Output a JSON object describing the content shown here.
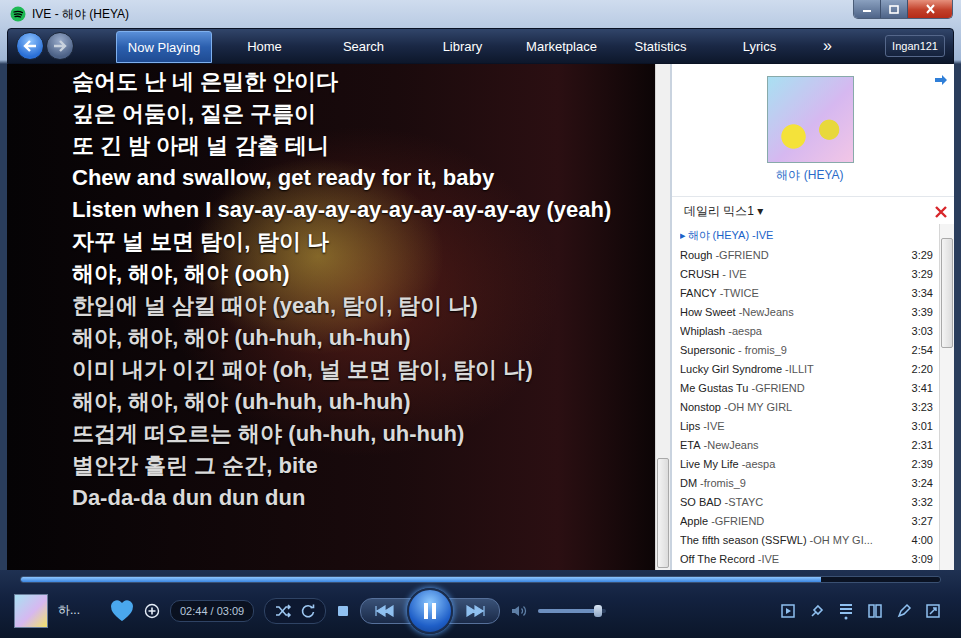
{
  "window": {
    "title": "IVE - 해야 (HEYA)"
  },
  "tabs": [
    {
      "label": "Now Playing",
      "selected": true
    },
    {
      "label": "Home",
      "selected": false
    },
    {
      "label": "Search",
      "selected": false
    },
    {
      "label": "Library",
      "selected": false
    },
    {
      "label": "Marketplace",
      "selected": false
    },
    {
      "label": "Statistics",
      "selected": false
    },
    {
      "label": "Lyrics",
      "selected": false
    }
  ],
  "nav_more": "»",
  "user": "Ingan121",
  "lyrics": [
    {
      "text": "숨어도 난 네 은밀한 안이다",
      "played": true
    },
    {
      "text": "깊은 어둠이, 짙은 구름이",
      "played": true
    },
    {
      "text": "또 긴 밤 아래 널 감출 테니",
      "played": true
    },
    {
      "text": "Chew and swallow, get ready for it, baby",
      "played": true
    },
    {
      "text": "Listen when I say-ay-ay-ay-ay-ay-ay-ay-ay-ay (yeah)",
      "played": true
    },
    {
      "text": "자꾸 널 보면 탐이, 탐이 나",
      "played": true
    },
    {
      "text": "해야, 해야, 해야 (ooh)",
      "played": true
    },
    {
      "text": "한입에 널 삼킬 때야 (yeah, 탐이, 탐이 나)",
      "played": false
    },
    {
      "text": "해야, 해야, 해야 (uh-huh, uh-huh)",
      "played": false
    },
    {
      "text": "이미 내가 이긴 패야 (oh, 널 보면 탐이, 탐이 나)",
      "played": false
    },
    {
      "text": "해야, 해야, 해야 (uh-huh, uh-huh)",
      "played": false
    },
    {
      "text": "뜨겁게 떠오르는 해야 (uh-huh, uh-huh)",
      "played": false
    },
    {
      "text": "별안간 홀린 그 순간, bite",
      "played": false
    },
    {
      "text": "Da-da-da dun dun dun",
      "played": false
    }
  ],
  "now_playing": {
    "caption": "해야 (HEYA)"
  },
  "playlist": {
    "name": "데일리 믹스1",
    "dropdown": "▾",
    "marker": "▸"
  },
  "queue": [
    {
      "title": "해야 (HEYA)",
      "artist": "-IVE",
      "duration": "",
      "selected": true
    },
    {
      "title": "Rough",
      "artist": "-GFRIEND",
      "duration": "3:29",
      "selected": false
    },
    {
      "title": "CRUSH",
      "artist": "- IVE",
      "duration": "3:29",
      "selected": false
    },
    {
      "title": "FANCY",
      "artist": "-TWICE",
      "duration": "3:34",
      "selected": false
    },
    {
      "title": "How Sweet",
      "artist": "-NewJeans",
      "duration": "3:39",
      "selected": false
    },
    {
      "title": "Whiplash",
      "artist": "-aespa",
      "duration": "3:03",
      "selected": false
    },
    {
      "title": "Supersonic",
      "artist": "- fromis_9",
      "duration": "2:54",
      "selected": false
    },
    {
      "title": "Lucky Girl Syndrome",
      "artist": "-ILLIT",
      "duration": "2:20",
      "selected": false
    },
    {
      "title": "Me Gustas Tu",
      "artist": "-GFRIEND",
      "duration": "3:41",
      "selected": false
    },
    {
      "title": "Nonstop",
      "artist": "-OH MY GIRL",
      "duration": "3:23",
      "selected": false
    },
    {
      "title": "Lips",
      "artist": "-IVE",
      "duration": "3:01",
      "selected": false
    },
    {
      "title": "ETA",
      "artist": "-NewJeans",
      "duration": "2:31",
      "selected": false
    },
    {
      "title": "Live My Life",
      "artist": "-aespa",
      "duration": "2:39",
      "selected": false
    },
    {
      "title": "DM",
      "artist": "-fromis_9",
      "duration": "3:24",
      "selected": false
    },
    {
      "title": "SO BAD",
      "artist": "-STAYC",
      "duration": "3:32",
      "selected": false
    },
    {
      "title": "Apple",
      "artist": "-GFRIEND",
      "duration": "3:27",
      "selected": false
    },
    {
      "title": "The fifth season (SSFWL)",
      "artist": "-OH MY GI...",
      "duration": "4:00",
      "selected": false
    },
    {
      "title": "Off The Record",
      "artist": "-IVE",
      "duration": "3:09",
      "selected": false
    }
  ],
  "player": {
    "track": "하...",
    "time": "02:44 / 03:09",
    "liked": true,
    "playing": true,
    "seek_level": 0.87,
    "volume_level": 0.9
  }
}
